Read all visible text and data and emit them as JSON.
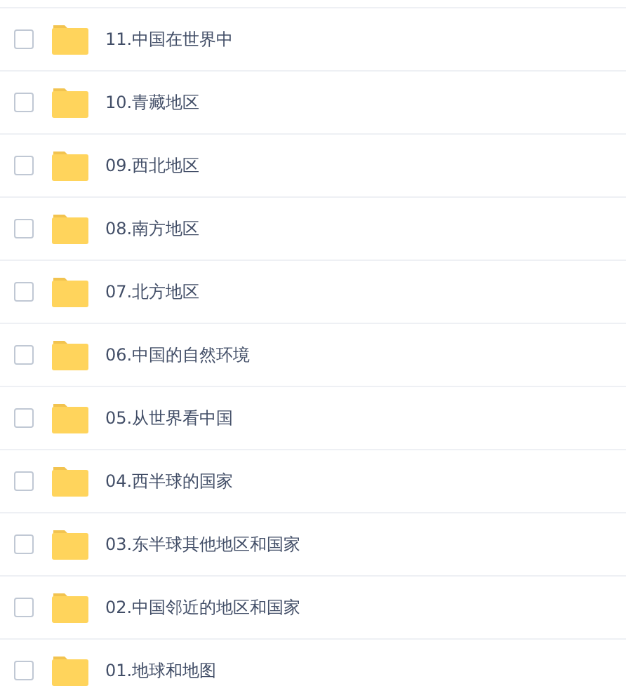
{
  "files": [
    {
      "name": "11.中国在世界中",
      "checked": false
    },
    {
      "name": "10.青藏地区",
      "checked": false
    },
    {
      "name": "09.西北地区",
      "checked": false
    },
    {
      "name": "08.南方地区",
      "checked": false
    },
    {
      "name": "07.北方地区",
      "checked": false
    },
    {
      "name": "06.中国的自然环境",
      "checked": false
    },
    {
      "name": "05.从世界看中国",
      "checked": false
    },
    {
      "name": "04.西半球的国家",
      "checked": false
    },
    {
      "name": "03.东半球其他地区和国家",
      "checked": false
    },
    {
      "name": "02.中国邻近的地区和国家",
      "checked": false
    },
    {
      "name": "01.地球和地图",
      "checked": false
    }
  ]
}
